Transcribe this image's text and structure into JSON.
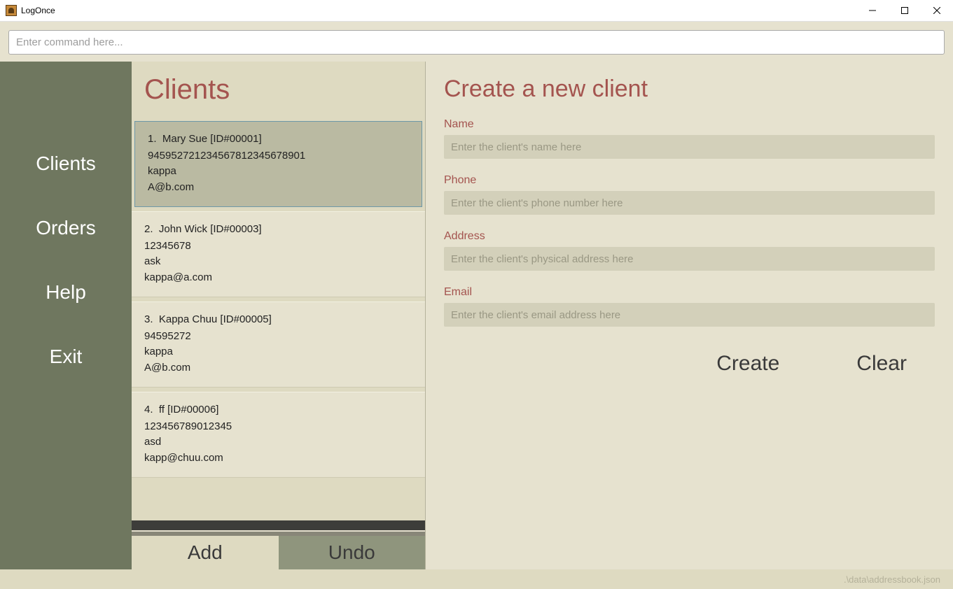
{
  "window": {
    "title": "LogOnce"
  },
  "command": {
    "placeholder": "Enter command here..."
  },
  "sidebar": {
    "items": [
      {
        "label": "Clients"
      },
      {
        "label": "Orders"
      },
      {
        "label": "Help"
      },
      {
        "label": "Exit"
      }
    ]
  },
  "mid": {
    "title": "Clients",
    "addLabel": "Add",
    "undoLabel": "Undo",
    "clients": [
      {
        "index": "1.",
        "name": "Mary Sue [ID#00001]",
        "phone": "945952721234567812345678901",
        "address": "kappa",
        "email": "A@b.com",
        "selected": true
      },
      {
        "index": "2.",
        "name": "John Wick [ID#00003]",
        "phone": "12345678",
        "address": "ask",
        "email": "kappa@a.com",
        "selected": false
      },
      {
        "index": "3.",
        "name": "Kappa Chuu [ID#00005]",
        "phone": "94595272",
        "address": "kappa",
        "email": "A@b.com",
        "selected": false
      },
      {
        "index": "4.",
        "name": "ff [ID#00006]",
        "phone": "123456789012345",
        "address": "asd",
        "email": "kapp@chuu.com",
        "selected": false
      }
    ]
  },
  "form": {
    "title": "Create a new client",
    "name": {
      "label": "Name",
      "placeholder": "Enter the client's name here"
    },
    "phone": {
      "label": "Phone",
      "placeholder": "Enter the client's phone number here"
    },
    "address": {
      "label": "Address",
      "placeholder": "Enter the client's physical address here"
    },
    "email": {
      "label": "Email",
      "placeholder": "Enter the client's email address here"
    },
    "createLabel": "Create",
    "clearLabel": "Clear"
  },
  "status": {
    "path": ".\\data\\addressbook.json"
  }
}
